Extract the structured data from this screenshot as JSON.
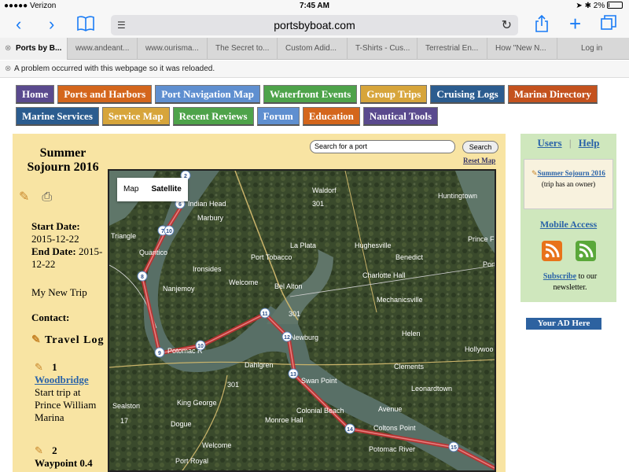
{
  "status_bar": {
    "carrier": "●●●●● Verizon",
    "time": "7:45 AM",
    "battery": "2%"
  },
  "browser": {
    "url": "portsbyboat.com",
    "tabs": [
      {
        "label": "Ports by B...",
        "active": true
      },
      {
        "label": "www.andeant...",
        "active": false
      },
      {
        "label": "www.ourisma...",
        "active": false
      },
      {
        "label": "The Secret to...",
        "active": false
      },
      {
        "label": "Custom Adid...",
        "active": false
      },
      {
        "label": "T-Shirts - Cus...",
        "active": false
      },
      {
        "label": "Terrestrial En...",
        "active": false
      },
      {
        "label": "How \"New N...",
        "active": false
      },
      {
        "label": "Log in",
        "active": false
      }
    ],
    "banner": "A problem occurred with this webpage so it was reloaded."
  },
  "site": {
    "nav_row1": [
      {
        "label": "Home",
        "color": "#5a4a8e"
      },
      {
        "label": "Ports and Harbors",
        "color": "#d4661c"
      },
      {
        "label": "Port Navigation Map",
        "color": "#5f8fd0"
      },
      {
        "label": "Waterfront Events",
        "color": "#4ea34a"
      },
      {
        "label": "Group Trips",
        "color": "#d7a53b"
      },
      {
        "label": "Cruising Logs",
        "color": "#2b5c8f"
      },
      {
        "label": "Marina Directory",
        "color": "#c4521e"
      }
    ],
    "nav_row2": [
      {
        "label": "Marine Services",
        "color": "#2b5c8f"
      },
      {
        "label": "Service Map",
        "color": "#d7a53b"
      },
      {
        "label": "Recent Reviews",
        "color": "#4ea34a"
      },
      {
        "label": "Forum",
        "color": "#5f8fd0"
      },
      {
        "label": "Education",
        "color": "#d4661c"
      },
      {
        "label": "Nautical Tools",
        "color": "#5a4a8e"
      }
    ],
    "trip": {
      "title": "Summer Sojourn 2016",
      "start_label": "Start Date:",
      "start_date": "2015-12-22",
      "end_label": "End Date:",
      "end_date": "2015-12-22",
      "description": "My New Trip",
      "contact_label": "Contact:",
      "travel_log_label": "Travel Log",
      "log": [
        {
          "num": "1",
          "place": "Woodbridge",
          "text": "Start trip at Prince William Marina"
        },
        {
          "num": "2",
          "place": "Waypoint 0.4"
        }
      ]
    },
    "search": {
      "placeholder": "Search for a port",
      "button": "Search",
      "reset": "Reset Map"
    },
    "map": {
      "type_map": "Map",
      "type_satellite": "Satellite",
      "places": [
        "Indian Head",
        "Waldorf",
        "Huntingtown",
        "Marbury",
        "Triangle",
        "La Plata",
        "Hughesville",
        "Prince Frederick",
        "Quantico",
        "Port Tobacco",
        "Benedict",
        "Port",
        "Ironsides",
        "Charlotte Hall",
        "Welcome",
        "Bel Alton",
        "Nanjemoy",
        "Mechanicsville",
        "Newburg",
        "Helen",
        "Hollywoo",
        "Potomac R",
        "Dahlgren",
        "Swan Point",
        "Clements",
        "Leonardtown",
        "Sealston",
        "King George",
        "Avenue",
        "Colonial Beach",
        "Monroe Hall",
        "Dogue",
        "Coltons Point",
        "Welcome",
        "Port Royal",
        "Potomac River",
        "301",
        "301",
        "301",
        "17"
      ],
      "waypoints": [
        "2",
        "6",
        "7",
        "10",
        "8",
        "9",
        "10",
        "11",
        "12",
        "13",
        "14",
        "15"
      ]
    },
    "sidebar": {
      "users": "Users",
      "separator": "|",
      "help": "Help",
      "trip_link": "Summer Sojourn 2016",
      "trip_note": "(trip has an owner)",
      "mobile": "Mobile Access",
      "subscribe_link": "Subscribe",
      "subscribe_text": "to our newsletter.",
      "ad": "Your AD Here"
    }
  }
}
